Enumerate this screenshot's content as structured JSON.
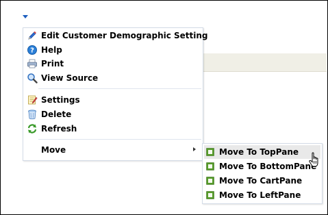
{
  "menu": {
    "items": [
      {
        "label": "Edit Customer Demographic Setting",
        "icon": "pencil-icon"
      },
      {
        "label": "Help",
        "icon": "help-icon"
      },
      {
        "label": "Print",
        "icon": "printer-icon"
      },
      {
        "label": "View Source",
        "icon": "magnifier-icon"
      },
      {
        "label": "Settings",
        "icon": "settings-notepad-icon"
      },
      {
        "label": "Delete",
        "icon": "trash-icon"
      },
      {
        "label": "Refresh",
        "icon": "refresh-icon"
      },
      {
        "label": "Move",
        "icon": ""
      }
    ]
  },
  "submenu": {
    "items": [
      {
        "label": "Move To TopPane",
        "icon": "pane-icon"
      },
      {
        "label": "Move To BottomPane",
        "icon": "pane-icon"
      },
      {
        "label": "Move To CartPane",
        "icon": "pane-icon"
      },
      {
        "label": "Move To LeftPane",
        "icon": "pane-icon"
      }
    ],
    "hovered_index": 0
  },
  "colors": {
    "menu_border": "#d3dbe6",
    "hover": "#e9e9e9",
    "pane_icon_green": "#5aa02c",
    "trigger_blue": "#1e5fbf"
  }
}
